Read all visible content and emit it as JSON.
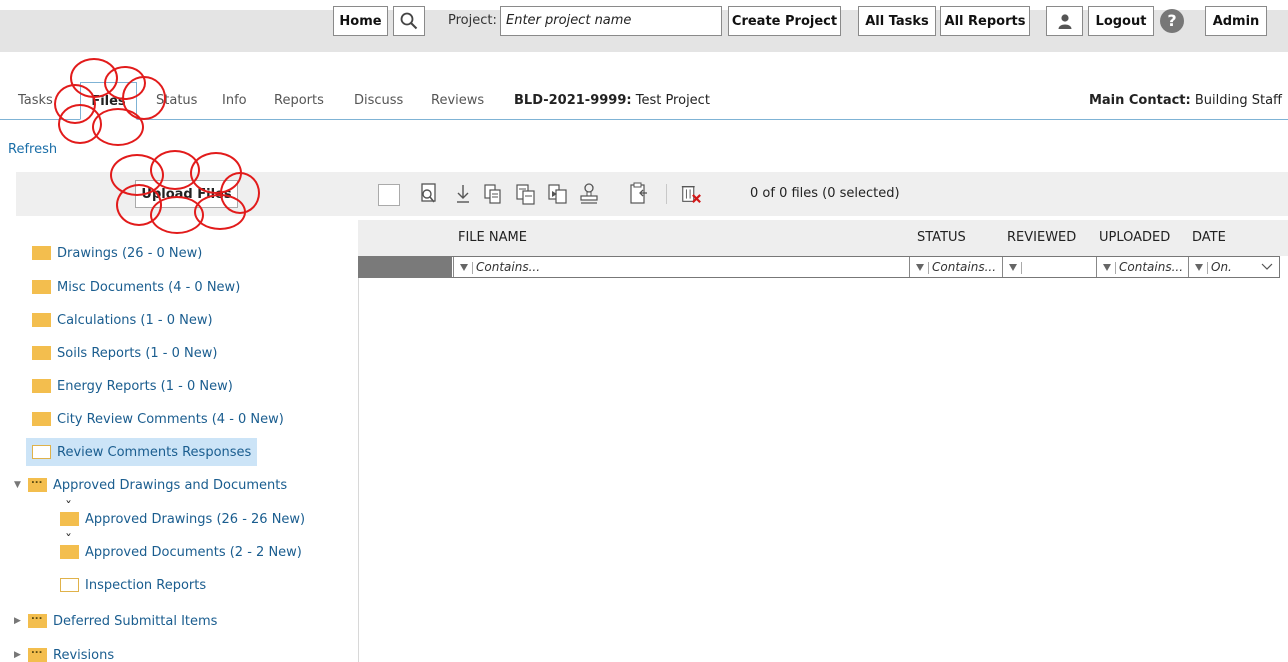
{
  "topbar": {
    "home": "Home",
    "project_label": "Project:",
    "project_placeholder": "Enter project name",
    "create_project": "Create Project",
    "all_tasks": "All Tasks",
    "all_reports": "All Reports",
    "logout": "Logout",
    "help_glyph": "?",
    "admin": "Admin"
  },
  "tabs": [
    "Tasks",
    "Files",
    "Status",
    "Info",
    "Reports",
    "Discuss",
    "Reviews"
  ],
  "project": {
    "id": "BLD-2021-9999:",
    "name": "Test Project"
  },
  "contact": {
    "label": "Main Contact:",
    "value": "Building Staff"
  },
  "refresh": "Refresh",
  "upload_button": "Upload Files",
  "file_count": "0 of 0 files (0 selected)",
  "grid": {
    "columns": [
      "FILE NAME",
      "STATUS",
      "REVIEWED",
      "UPLOADED",
      "DATE"
    ],
    "filters": [
      "Contains...",
      "Contains...",
      "",
      "Contains...",
      "On."
    ]
  },
  "tree": [
    {
      "label": "Drawings (26 - 0 New)"
    },
    {
      "label": "Misc Documents (4 - 0 New)"
    },
    {
      "label": "Calculations (1 - 0 New)"
    },
    {
      "label": "Soils Reports (1 - 0 New)"
    },
    {
      "label": "Energy Reports (1 - 0 New)"
    },
    {
      "label": "City Review Comments (4 - 0 New)"
    },
    {
      "label": "Review Comments Responses"
    },
    {
      "label": "Approved Drawings and Documents"
    },
    {
      "label": "Approved Drawings (26 - 26 New)"
    },
    {
      "label": "Approved Documents (2 - 2 New)"
    },
    {
      "label": "Inspection Reports"
    },
    {
      "label": "Deferred Submittal Items"
    },
    {
      "label": "Revisions"
    }
  ],
  "colors": {
    "link": "#1a5d8f",
    "tab_border": "#7fb3d5",
    "selected_bg": "#cce4f7",
    "folder": "#f3be4e",
    "callout": "#e21b1b"
  },
  "icons": [
    "search-icon",
    "user-icon",
    "help-icon",
    "preview-icon",
    "download-icon",
    "copy-icon",
    "move-icon",
    "merge-icon",
    "stamp-icon",
    "paste-icon",
    "delete-icon"
  ]
}
